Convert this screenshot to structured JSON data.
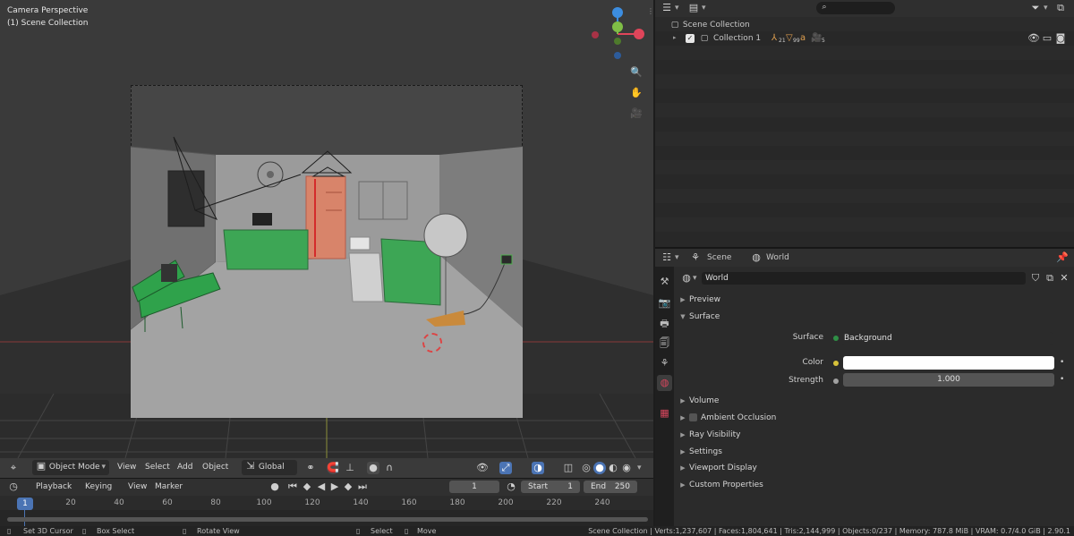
{
  "viewport": {
    "title": "Camera Perspective",
    "collection": "(1) Scene Collection",
    "header": {
      "editor_icon": "3d-viewport-icon",
      "mode": "Object Mode",
      "menus": [
        "View",
        "Select",
        "Add",
        "Object"
      ],
      "transform_orientation": "Global"
    }
  },
  "timeline": {
    "menus": [
      "Playback",
      "Keying",
      "View",
      "Marker"
    ],
    "current_frame": "1",
    "start_label": "Start",
    "start_value": "1",
    "end_label": "End",
    "end_value": "250",
    "ruler": [
      "1",
      "20",
      "40",
      "60",
      "80",
      "100",
      "120",
      "140",
      "160",
      "180",
      "200",
      "220",
      "240"
    ]
  },
  "status": {
    "items": [
      "Set 3D Cursor",
      "Box Select",
      "Rotate View",
      "Select",
      "Move"
    ],
    "stats": "Scene Collection | Verts:1,237,607 | Faces:1,804,641 | Tris:2,144,999 | Objects:0/237 | Memory: 787.8 MiB | VRAM: 0.7/4.0 GiB | 2.90.1"
  },
  "outliner": {
    "search_placeholder": "",
    "scene_collection": "Scene Collection",
    "collection": "Collection 1",
    "counts": [
      "21",
      "99",
      "",
      "5"
    ]
  },
  "properties": {
    "scene_label": "Scene",
    "world_label": "World",
    "world_name": "World",
    "panels": {
      "preview": "Preview",
      "surface": "Surface",
      "volume": "Volume",
      "ambient_occlusion": "Ambient Occlusion",
      "ray_visibility": "Ray Visibility",
      "settings": "Settings",
      "viewport_display": "Viewport Display",
      "custom_properties": "Custom Properties"
    },
    "surface": {
      "surface_label": "Surface",
      "surface_value": "Background",
      "color_label": "Color",
      "color_value": "#ffffff",
      "strength_label": "Strength",
      "strength_value": "1.000"
    }
  },
  "colors": {
    "accent": "#4b74b4",
    "x_axis": "#e0455a",
    "y_axis": "#7fbe46",
    "z_axis": "#3c8de0",
    "surface_green": "#2f8f46"
  }
}
